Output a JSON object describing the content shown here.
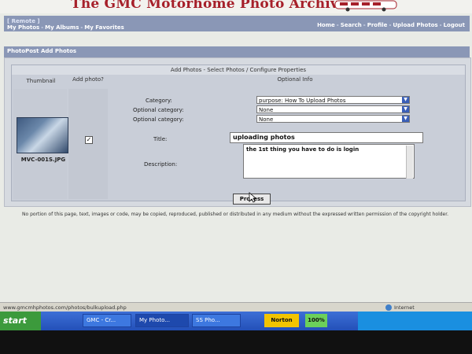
{
  "header": {
    "title": "The GMC Motorhome Photo Archive"
  },
  "nav": {
    "welcome": "[ Remote ]",
    "left_links": [
      "My Photos",
      "My Albums",
      "My Favorites"
    ],
    "right_links": [
      "Home",
      "Search",
      "Profile",
      "Upload Photos",
      "Logout"
    ]
  },
  "section": {
    "title": "PhotoPost Add Photos"
  },
  "form": {
    "heading": "Add Photos - Select Photos / Configure Properties",
    "col_thumbnail": "Thumbnail",
    "col_add_photo": "Add photo?",
    "col_optional_info": "Optional Info",
    "thumbnail_caption": "MVC-001S.JPG",
    "add_photo_checked": "✓",
    "category_label": "Category:",
    "category_value": "purpose: How To Upload Photos",
    "optional_category_label_1": "Optional category:",
    "optional_category_value_1": "None",
    "optional_category_label_2": "Optional category:",
    "optional_category_value_2": "None",
    "title_label": "Title:",
    "title_value": "uploading photos",
    "description_label": "Description:",
    "description_value": "the 1st thing you have to do is login",
    "process_button": "Process"
  },
  "footer": {
    "copyright": "No portion of this page, text, images or code, may be copied, reproduced, published or distributed in any medium without the expressed written permission of the copyright holder."
  },
  "statusbar": {
    "url": "www.gmcmhphotos.com/photos/bulkupload.php",
    "zone": "Internet"
  },
  "taskbar": {
    "start": "start",
    "tasks": [
      "GMC - Cr...",
      "My Photo...",
      "SS Pho..."
    ],
    "norton": "Norton",
    "percent": "100%"
  },
  "colors": {
    "nav_bar": "#8a97b6",
    "title_red": "#a6202a",
    "taskbar_blue": "#2350b8",
    "start_green": "#3c9a3c"
  }
}
